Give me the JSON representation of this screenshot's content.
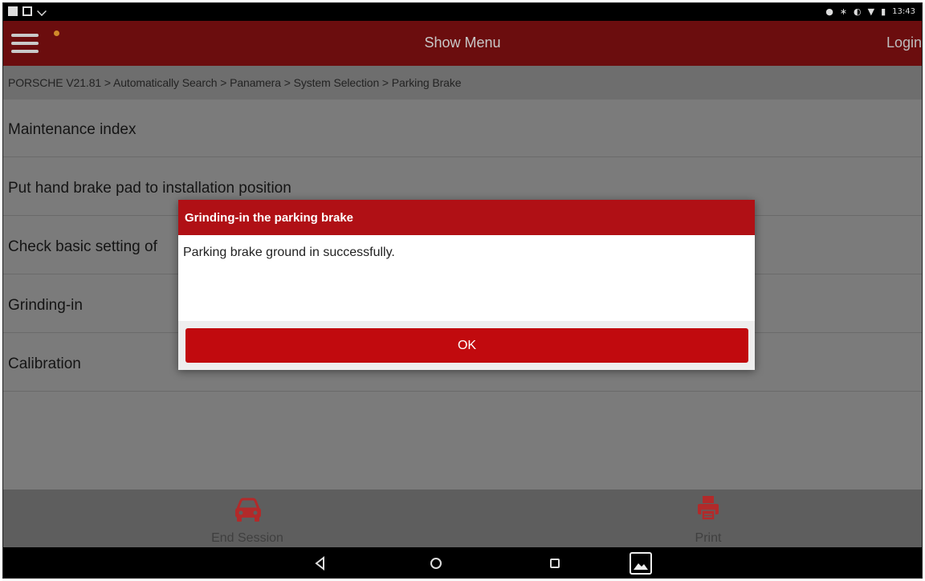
{
  "status_bar": {
    "time": "13:43"
  },
  "app_bar": {
    "title": "Show Menu",
    "login_label": "Login"
  },
  "breadcrumb": "PORSCHE V21.81 > Automatically Search > Panamera > System Selection > Parking Brake",
  "menu_items": [
    "Maintenance index",
    "Put hand brake pad to installation position",
    "Check basic setting of",
    "Grinding-in",
    "Calibration"
  ],
  "toolbar": {
    "end_session_label": "End Session",
    "print_label": "Print"
  },
  "dialog": {
    "title": "Grinding-in the parking brake",
    "message": "Parking brake ground in successfully.",
    "ok_label": "OK"
  },
  "colors": {
    "app_bar": "#6b0d0e",
    "dialog_title": "#b01015",
    "ok_button": "#c10a0e",
    "toolbar_icon": "#b22a2a"
  }
}
